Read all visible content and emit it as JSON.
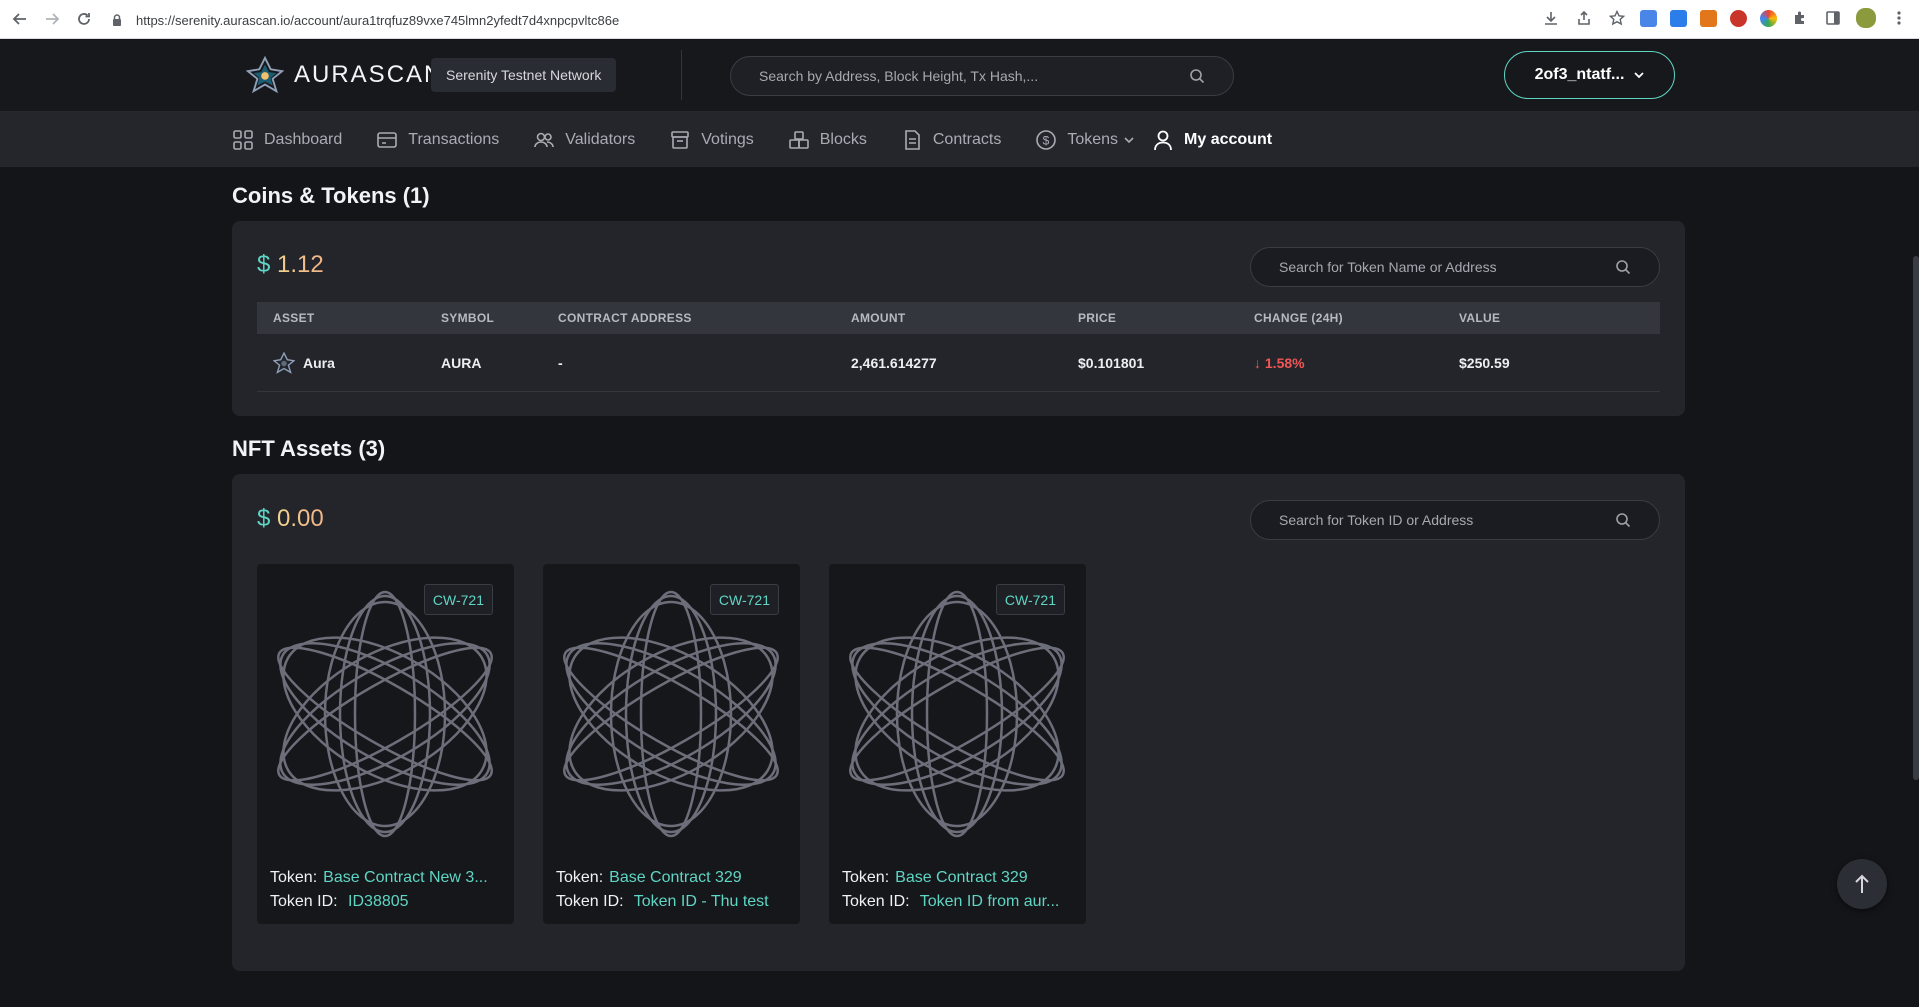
{
  "browser": {
    "url": "https://serenity.aurascan.io/account/aura1trqfuz89vxe745lmn2yfedt7d4xnpcpvltc86e"
  },
  "header": {
    "logo_text": "AURASCAN",
    "network": "Serenity Testnet Network",
    "search_placeholder": "Search by Address, Block Height, Tx Hash,...",
    "wallet_label": "2of3_ntatf..."
  },
  "nav": {
    "items": [
      {
        "label": "Dashboard",
        "icon": "dashboard-icon"
      },
      {
        "label": "Transactions",
        "icon": "transactions-icon"
      },
      {
        "label": "Validators",
        "icon": "validators-icon"
      },
      {
        "label": "Votings",
        "icon": "votings-icon"
      },
      {
        "label": "Blocks",
        "icon": "blocks-icon"
      },
      {
        "label": "Contracts",
        "icon": "contracts-icon"
      },
      {
        "label": "Tokens",
        "icon": "tokens-icon"
      },
      {
        "label": "My account",
        "icon": "user-icon"
      }
    ]
  },
  "coins": {
    "title": "Coins & Tokens (1)",
    "currency": "$",
    "total": "1.12",
    "search_placeholder": "Search for Token Name or Address",
    "columns": [
      "ASSET",
      "SYMBOL",
      "CONTRACT ADDRESS",
      "AMOUNT",
      "PRICE",
      "CHANGE (24H)",
      "VALUE"
    ],
    "rows": [
      {
        "asset": "Aura",
        "symbol": "AURA",
        "contract": "-",
        "amount": "2,461.614277",
        "price": "$0.101801",
        "change_arrow": "↓",
        "change": "1.58%",
        "value": "$250.59"
      }
    ]
  },
  "nfts": {
    "title": "NFT Assets (3)",
    "currency": "$",
    "total": "0.00",
    "search_placeholder": "Search for Token ID or Address",
    "token_label": "Token:",
    "token_id_label": "Token ID:",
    "cards": [
      {
        "badge": "CW-721",
        "token": "Base Contract New 3...",
        "token_id": "ID38805"
      },
      {
        "badge": "CW-721",
        "token": "Base Contract 329",
        "token_id": "Token ID - Thu test"
      },
      {
        "badge": "CW-721",
        "token": "Base Contract 329",
        "token_id": "Token ID from aur..."
      }
    ]
  },
  "colors": {
    "accent": "#5fd6c4",
    "negative": "#f05656",
    "background": "#141519",
    "card": "#23252b"
  }
}
